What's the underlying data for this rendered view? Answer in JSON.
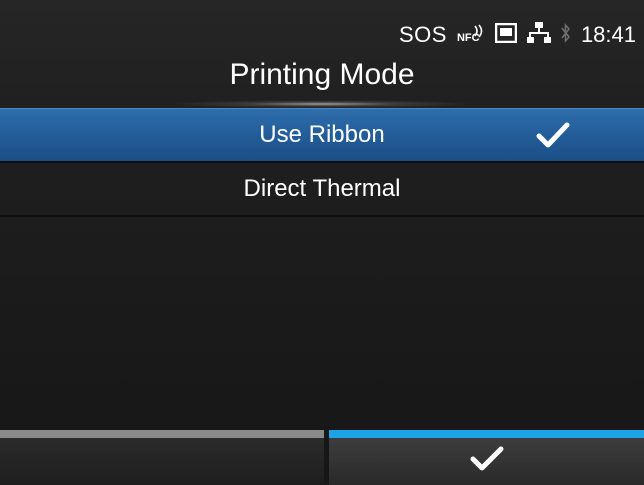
{
  "status_bar": {
    "sos": "SOS",
    "nfc": "NFC",
    "time": "18:41",
    "icons": [
      "nfc-icon",
      "card-icon",
      "network-icon",
      "bluetooth-icon"
    ]
  },
  "title": "Printing Mode",
  "options": [
    {
      "label": "Use Ribbon",
      "selected": true
    },
    {
      "label": "Direct Thermal",
      "selected": false
    }
  ],
  "buttons": {
    "left": {
      "label": ""
    },
    "right": {
      "icon": "check-icon"
    }
  },
  "colors": {
    "selection": "#235d99",
    "accent": "#1fa3e8",
    "left_button_bar": "#8a8a8a"
  }
}
